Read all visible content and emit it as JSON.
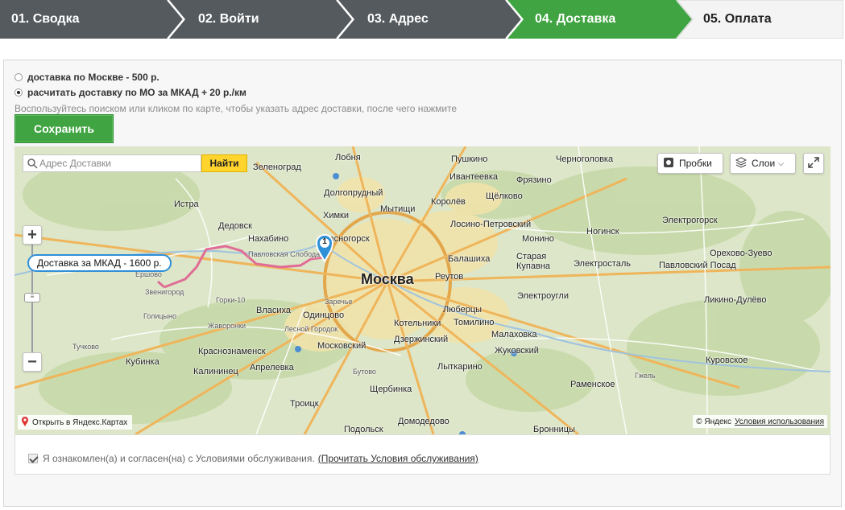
{
  "steps": [
    {
      "label": "01. Сводка",
      "state": "done"
    },
    {
      "label": "02. Войти",
      "state": "done"
    },
    {
      "label": "03. Адрес",
      "state": "done"
    },
    {
      "label": "04. Доставка",
      "state": "active"
    },
    {
      "label": "05. Оплата",
      "state": "todo"
    }
  ],
  "colors": {
    "step_done": "#555a5e",
    "step_active": "#3fa441",
    "step_todo": "#f4f4f4",
    "route": "#e06c95",
    "bubble_border": "#2f8fd8"
  },
  "delivery": {
    "option1": "доставка по Москве - 500 р.",
    "option2": "расчитать доставку по МО за МКАД + 20 р./км",
    "selected": 2,
    "hint": "Воспользуйтесь поиском или кликом по карте, чтобы указать адрес доставки, после чего нажмите",
    "save_label": "Сохранить"
  },
  "map": {
    "search_placeholder": "Адрес Доставки",
    "find_label": "Найти",
    "traffic_label": "Пробки",
    "layers_label": "Слои",
    "zoom_in": "+",
    "zoom_out": "−",
    "route_label": "Доставка за МКАД - 1600 р.",
    "marker_number": "1",
    "open_in_yandex": "Открыть в Яндекс.Картах",
    "copyright": "© Яндекс",
    "terms_of_use": "Условия использования",
    "cities": [
      "Зеленоград",
      "Лобня",
      "Пушкино",
      "Черноголовка",
      "Долгопрудный",
      "Ивантеевка",
      "Фрязино",
      "Истра",
      "Химки",
      "Мытищи",
      "Королёв",
      "Щёлково",
      "Лосино-Петровский",
      "Дедовск",
      "Красногорск",
      "Ногинск",
      "Электрогорск",
      "Нахабино",
      "Монино",
      "Орехово-Зуево",
      "Павловская Слобода",
      "Балашиха",
      "Старая Купавна",
      "Электросталь",
      "Павловский Посад",
      "Звенигород",
      "Москва",
      "Реутов",
      "Ликино-Дулёво",
      "Горки-10",
      "Заречье",
      "Электроугли",
      "Власиха",
      "Одинцово",
      "Люберцы",
      "Котельники",
      "Томилино",
      "Лесной Городок",
      "Малаховка",
      "Кубинка",
      "Краснознаменск",
      "Московский",
      "Дзержинский",
      "Жуковский",
      "Куровское",
      "Калининец",
      "Апрелевка",
      "Лыткарино",
      "Щербинка",
      "Троицк",
      "Подольск",
      "Домодедово",
      "Бронницы",
      "Ершово",
      "Тучково",
      "Раменское",
      "Гжель",
      "Бутово",
      "Жаворонки",
      "Голицыно"
    ]
  },
  "terms": {
    "checked": true,
    "text": "Я ознакомлен(а) и согласен(на) с Условиями обслуживания.",
    "link": "(Прочитать Условия обслуживания)"
  }
}
